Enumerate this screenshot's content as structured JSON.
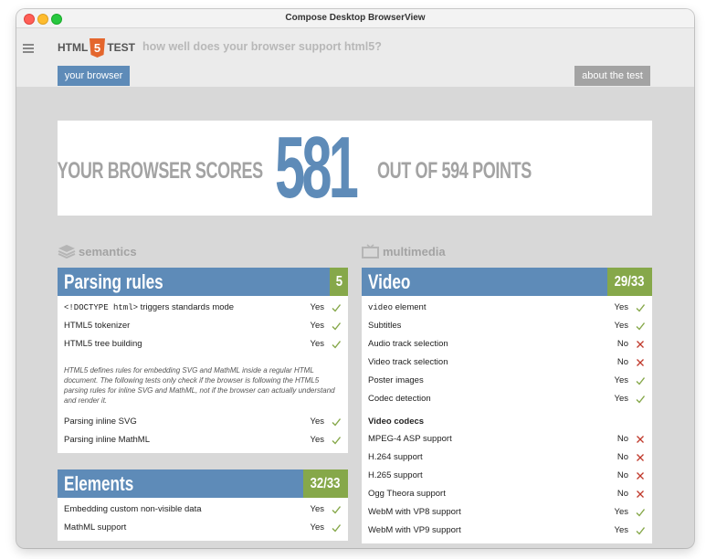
{
  "window": {
    "title": "Compose Desktop BrowserView"
  },
  "header": {
    "logo_left": "HTML",
    "logo_num": "5",
    "logo_right": "TEST",
    "tagline": "how well does your browser support html5?",
    "your_browser": "your browser",
    "about": "about the test"
  },
  "score": {
    "prefix": "YOUR BROWSER SCORES",
    "value": "581",
    "suffix": "OUT OF 594 POINTS"
  },
  "sections": {
    "semantics": "semantics",
    "multimedia": "multimedia"
  },
  "parsing": {
    "title": "Parsing rules",
    "score": "5",
    "rows": [
      {
        "label_mono": "<!DOCTYPE html>",
        "label": " triggers standards mode",
        "result": "Yes"
      },
      {
        "label": "HTML5 tokenizer",
        "result": "Yes"
      },
      {
        "label": "HTML5 tree building",
        "result": "Yes"
      }
    ],
    "note": "HTML5 defines rules for embedding SVG and MathML inside a regular HTML document. The following tests only check if the browser is following the HTML5 parsing rules for inline SVG and MathML, not if the browser can actually understand and render it.",
    "rows2": [
      {
        "label": "Parsing inline SVG",
        "result": "Yes"
      },
      {
        "label": "Parsing inline MathML",
        "result": "Yes"
      }
    ]
  },
  "elements": {
    "title": "Elements",
    "score": "32/33",
    "rows": [
      {
        "label": "Embedding custom non-visible data",
        "result": "Yes"
      },
      {
        "label": "MathML support",
        "result": "Yes"
      }
    ]
  },
  "video": {
    "title": "Video",
    "score": "29/33",
    "rows": [
      {
        "label_mono": "video",
        "label": " element",
        "result": "Yes"
      },
      {
        "label": "Subtitles",
        "result": "Yes"
      },
      {
        "label": "Audio track selection",
        "result": "No"
      },
      {
        "label": "Video track selection",
        "result": "No"
      },
      {
        "label": "Poster images",
        "result": "Yes"
      },
      {
        "label": "Codec detection",
        "result": "Yes"
      }
    ],
    "codecs_heading": "Video codecs",
    "codecs": [
      {
        "label": "MPEG-4 ASP support",
        "result": "No"
      },
      {
        "label": "H.264 support",
        "result": "No"
      },
      {
        "label": "H.265 support",
        "result": "No"
      },
      {
        "label": "Ogg Theora support",
        "result": "No"
      },
      {
        "label": "WebM with VP8 support",
        "result": "Yes"
      },
      {
        "label": "WebM with VP9 support",
        "result": "Yes"
      }
    ]
  },
  "colors": {
    "accent": "#5e8bb8",
    "score_green": "#86a84a",
    "yes": "#86a84a",
    "no": "#c0392b"
  }
}
